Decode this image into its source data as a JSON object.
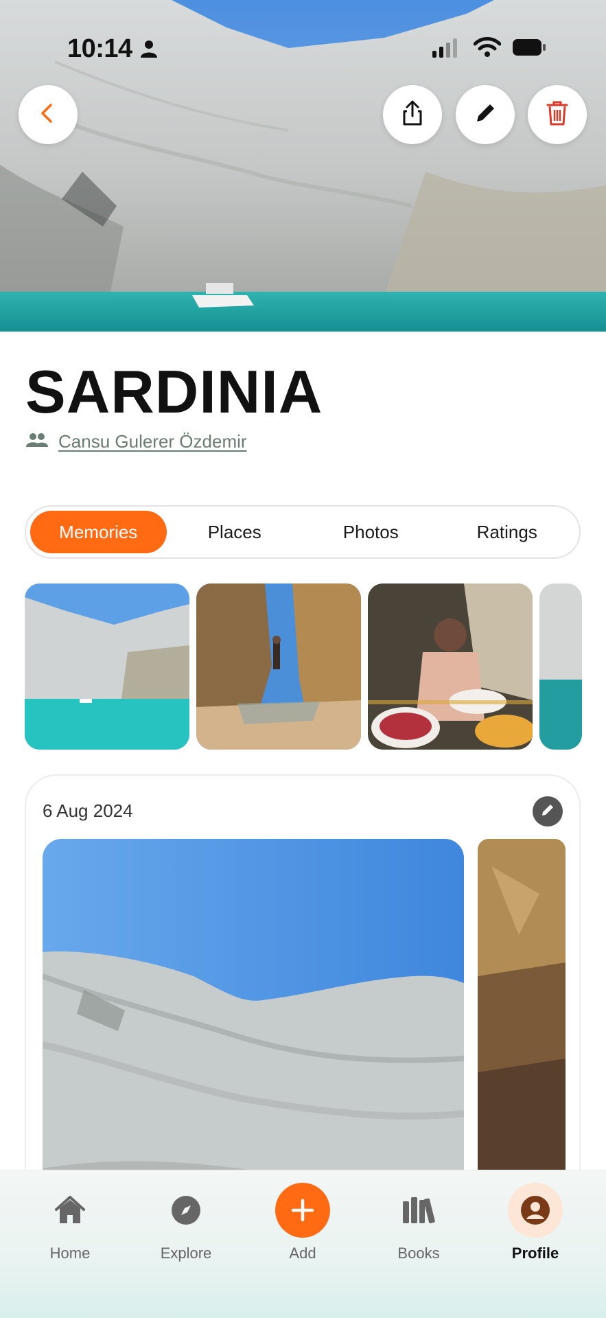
{
  "status_bar": {
    "time": "10:14"
  },
  "trip": {
    "title": "SARDINIA",
    "owner": "Cansu Gulerer Özdemir"
  },
  "tabs": [
    {
      "label": "Memories",
      "active": true
    },
    {
      "label": "Places",
      "active": false
    },
    {
      "label": "Photos",
      "active": false
    },
    {
      "label": "Ratings",
      "active": false
    }
  ],
  "memory": {
    "date": "6 Aug 2024"
  },
  "nav": {
    "home": "Home",
    "explore": "Explore",
    "add": "Add",
    "books": "Books",
    "profile": "Profile",
    "active": "Profile"
  },
  "colors": {
    "accent": "#ff6a13",
    "delete_red": "#d83a2a",
    "owner_text": "#6a7d72"
  },
  "icons": [
    "back-icon",
    "share-icon",
    "edit-icon",
    "trash-icon",
    "group-icon",
    "home-icon",
    "compass-icon",
    "plus-icon",
    "books-icon",
    "profile-icon"
  ]
}
